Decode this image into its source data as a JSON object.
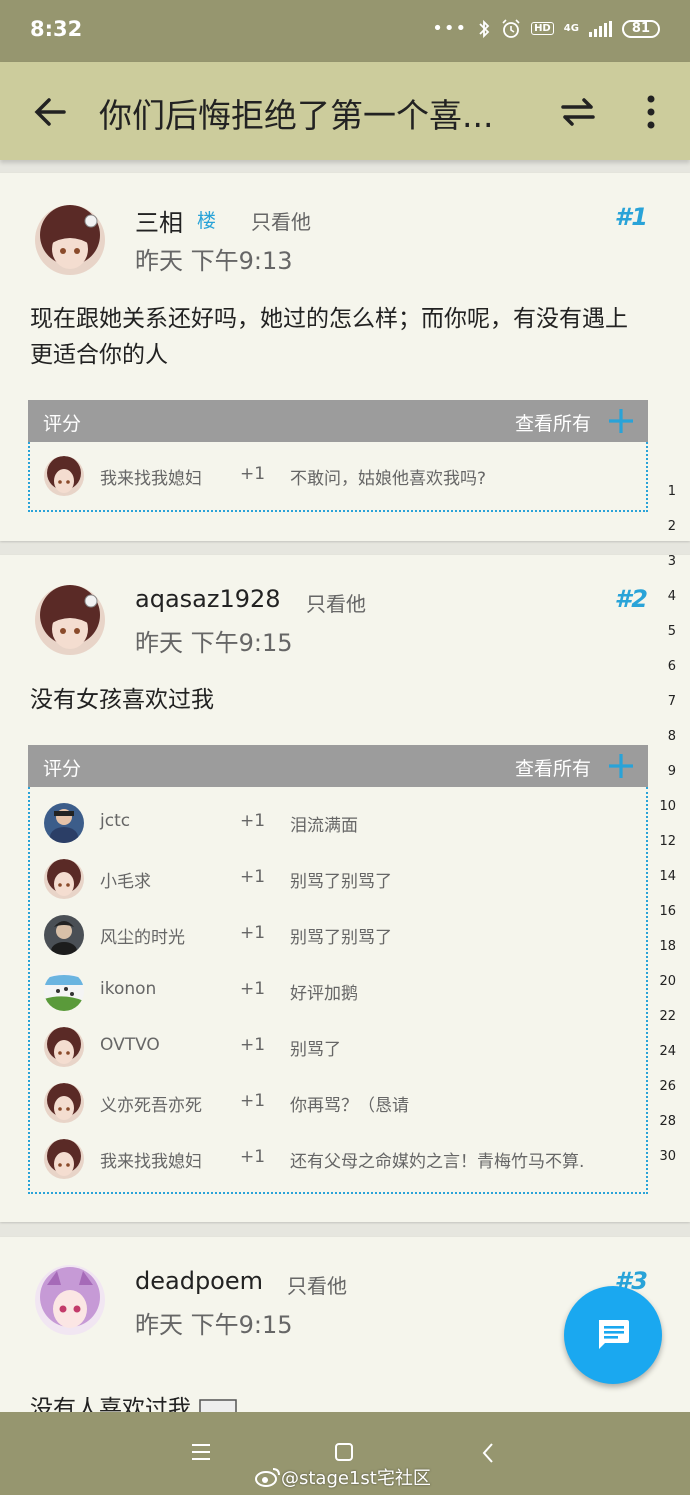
{
  "status_bar": {
    "time": "8:32",
    "network": "4G",
    "battery": "81"
  },
  "toolbar": {
    "title": "你们后悔拒绝了第一个喜..."
  },
  "posts": [
    {
      "author": "三相",
      "tag": "楼",
      "only_him": "只看他",
      "time": "昨天 下午9:13",
      "floor": "#1",
      "body": "现在跟她关系还好吗，她过的怎么样；而你呢，有没有遇上更适合你的人",
      "rating": {
        "label": "评分",
        "view_all": "查看所有",
        "rows": [
          {
            "user": "我来找我媳妇",
            "score": "+1",
            "reason": "不敢问，姑娘他喜欢我吗?"
          }
        ]
      }
    },
    {
      "author": "aqasaz1928",
      "only_him": "只看他",
      "time": "昨天 下午9:15",
      "floor": "#2",
      "body": "没有女孩喜欢过我",
      "rating": {
        "label": "评分",
        "view_all": "查看所有",
        "rows": [
          {
            "user": "jctc",
            "score": "+1",
            "reason": "泪流满面"
          },
          {
            "user": "小毛求",
            "score": "+1",
            "reason": "别骂了别骂了"
          },
          {
            "user": "风尘的时光",
            "score": "+1",
            "reason": "别骂了别骂了"
          },
          {
            "user": "ikonon",
            "score": "+1",
            "reason": "好评加鹅"
          },
          {
            "user": "OVTVO",
            "score": "+1",
            "reason": "别骂了"
          },
          {
            "user": "义亦死吾亦死",
            "score": "+1",
            "reason": "你再骂？（恳请"
          },
          {
            "user": "我来找我媳妇",
            "score": "+1",
            "reason": "还有父母之命媒妁之言！青梅竹马不算."
          }
        ]
      }
    },
    {
      "author": "deadpoem",
      "only_him": "只看他",
      "time": "昨天 下午9:15",
      "floor": "#3",
      "body": "没有人喜欢过我"
    }
  ],
  "line_numbers": [
    "1",
    "2",
    "3",
    "4",
    "5",
    "6",
    "7",
    "8",
    "9",
    "10",
    "12",
    "14",
    "16",
    "18",
    "20",
    "22",
    "24",
    "26",
    "28",
    "30"
  ],
  "watermark": "@stage1st宅社区",
  "colors": {
    "accent": "#29a3d8",
    "toolbar": "#cccc9c",
    "statusbar": "#96966f",
    "fab": "#1aa8f0"
  }
}
